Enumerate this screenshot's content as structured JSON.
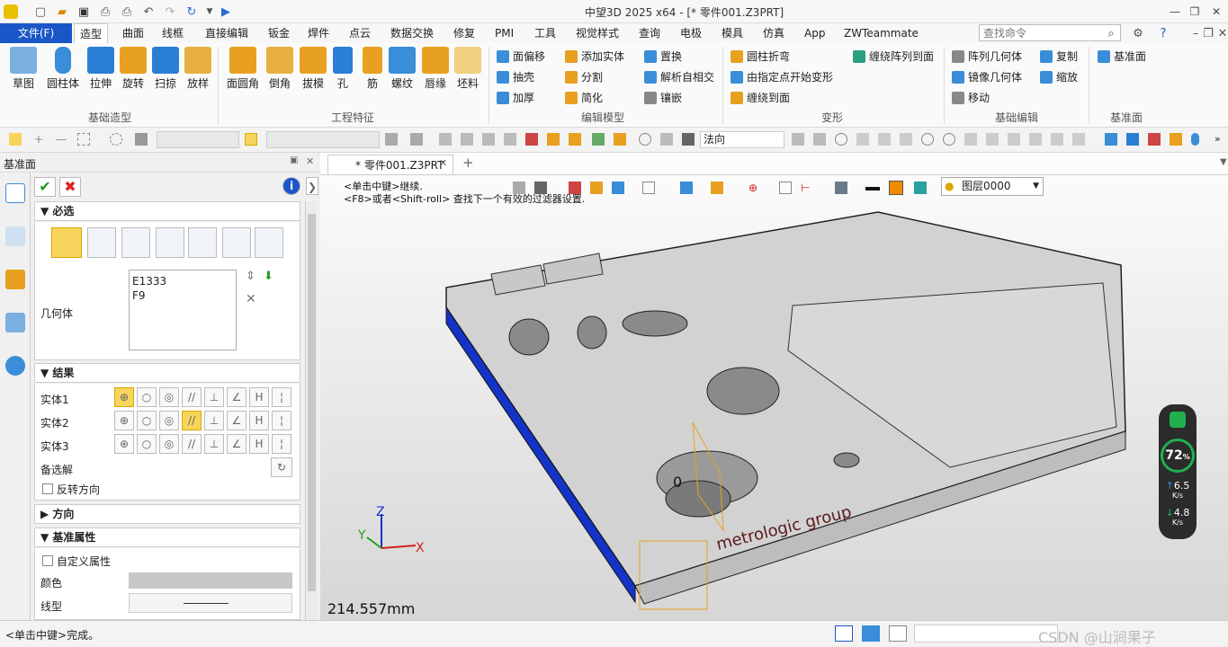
{
  "app": {
    "title": "中望3D 2025 x64 - [* 零件001.Z3PRT]"
  },
  "menu": {
    "file": "文件(F)",
    "tabs": [
      "造型",
      "曲面",
      "线框",
      "直接编辑",
      "钣金",
      "焊件",
      "点云",
      "数据交换",
      "修复",
      "PMI",
      "工具",
      "视觉样式",
      "查询",
      "电极",
      "模具",
      "仿真",
      "App",
      "ZWTeammate"
    ],
    "search_placeholder": "查找命令"
  },
  "ribbon": {
    "basic": {
      "items": [
        "草图",
        "圆柱体",
        "拉伸",
        "旋转",
        "扫掠",
        "放样"
      ],
      "group": "基础造型"
    },
    "engineering": {
      "items": [
        "面圆角",
        "倒角",
        "拔模",
        "孔",
        "筋",
        "螺纹",
        "唇缘",
        "坯料"
      ],
      "group": "工程特征"
    },
    "edit": {
      "items": [
        "面偏移",
        "添加实体",
        "置换",
        "抽壳",
        "分割",
        "解析自相交",
        "加厚",
        "简化",
        "镶嵌"
      ],
      "group": "编辑模型"
    },
    "deform": {
      "items": [
        "圆柱折弯",
        "缠绕阵列到面",
        "由指定点开始变形",
        "缠绕到面"
      ],
      "group": "变形"
    },
    "basic_edit": {
      "items": [
        "阵列几何体",
        "复制",
        "镜像几何体",
        "缩放",
        "移动"
      ],
      "group": "基础编辑"
    },
    "datum": {
      "items": [
        "基准面"
      ],
      "group": "基准面"
    }
  },
  "toolbar2": {
    "filter_value": "法向"
  },
  "panel": {
    "title": "基准面",
    "section_required": "必选",
    "geometry_label": "几何体",
    "geometry_items": [
      "E1333",
      "F9"
    ],
    "section_result": "结果",
    "entities": [
      "实体1",
      "实体2",
      "实体3"
    ],
    "alt_solution": "备选解",
    "reverse": "反转方向",
    "section_direction": "方向",
    "section_datum_attrs": "基准属性",
    "custom_attr": "自定义属性",
    "color_label": "颜色",
    "linetype_label": "线型"
  },
  "viewport": {
    "doc_tab": "* 零件001.Z3PRT",
    "hint1": "<单击中键>继续.",
    "hint2": "<F8>或者<Shift-roll> 查找下一个有效的过滤器设置.",
    "layer": "图层0000",
    "measure": "214.557mm",
    "brand": "metrologic group",
    "axis_z": "Z",
    "axis_x": "X",
    "axis_y": "Y",
    "value_zero": "0"
  },
  "gauge": {
    "percent": "72",
    "up": "6.5",
    "down": "4.8",
    "unit": "K/s"
  },
  "status": {
    "text": "<单击中键>完成。",
    "watermark": "CSDN @山涧果子"
  },
  "colors": {
    "accent": "#1a56c7",
    "blue_face": "#1434c8",
    "highlight": "#f7d55c"
  }
}
